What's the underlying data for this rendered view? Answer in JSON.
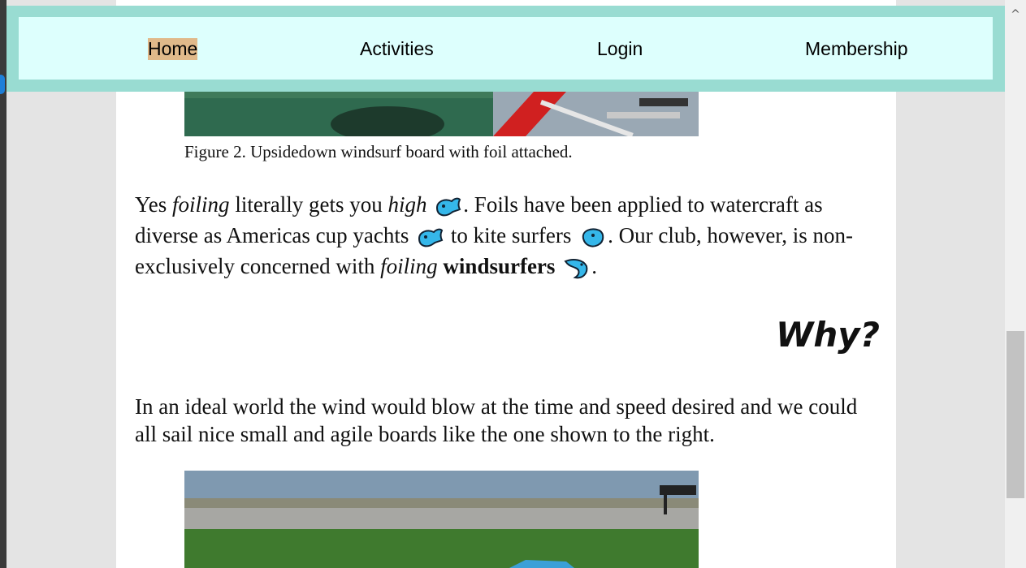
{
  "nav": {
    "items": [
      {
        "label": "Home",
        "active": true
      },
      {
        "label": "Activities"
      },
      {
        "label": "Login"
      },
      {
        "label": "Membership"
      }
    ]
  },
  "figure2": {
    "caption": "Figure 2. Upsidedown windsurf board with foil attached."
  },
  "paragraph1": {
    "t1": "Yes ",
    "t2": "foiling",
    "t3": " literally gets you ",
    "t4": "high",
    "t5": ". Foils have been applied to watercraft as diverse as Americas cup yachts",
    "t6": " to kite surfers",
    "t7": ". Our club, however, is non-exclusively concerned with ",
    "t8": "foiling",
    "t9": " ",
    "t10": "windsurfers",
    "t11": "."
  },
  "section": {
    "heading": "Why?"
  },
  "paragraph2": {
    "text": "In an ideal world the wind would blow at the time and speed desired and we could all sail nice small and agile boards like the one shown to the right."
  },
  "icons": {
    "whale": "whale-icon",
    "dolphin": "dolphin-icon",
    "scroll_up": "chevron-up-icon"
  },
  "colors": {
    "nav_outer": "#99dcd2",
    "nav_inner": "#ddfffd",
    "active_highlight": "#e0b98a",
    "emoji_blue": "#35b7ea"
  },
  "scroll": {
    "up_arrow": "^"
  }
}
